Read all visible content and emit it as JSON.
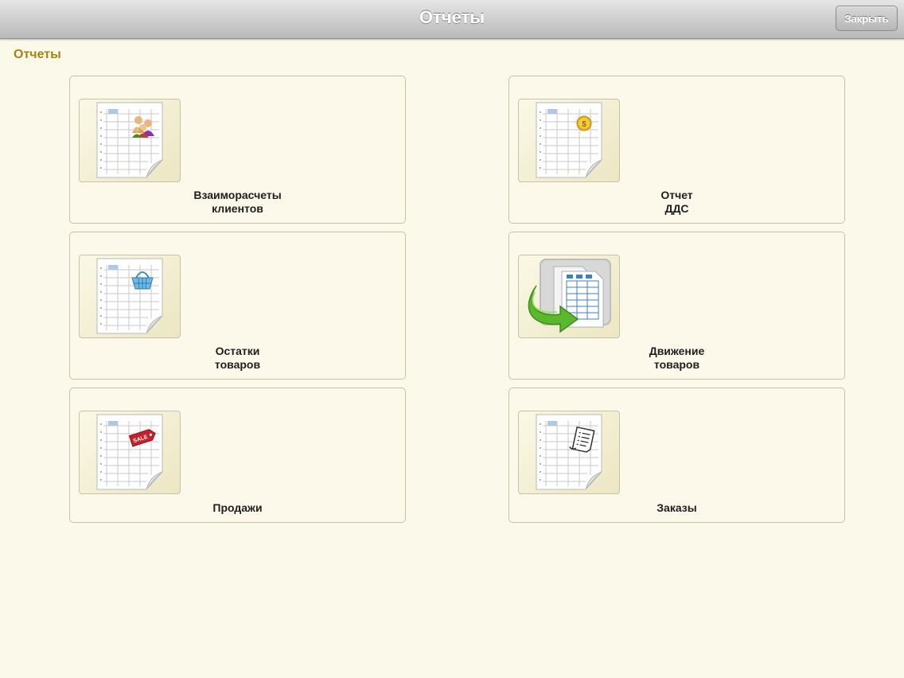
{
  "header": {
    "title": "Отчеты",
    "close_label": "Закрыть"
  },
  "section_title": "Отчеты",
  "reports": [
    {
      "line1": "Взаиморасчеты",
      "line2": "клиентов",
      "icon": "clients-report-icon"
    },
    {
      "line1": "Отчет",
      "line2": "ДДС",
      "icon": "cash-flow-report-icon"
    },
    {
      "line1": "Остатки",
      "line2": "товаров",
      "icon": "stock-report-icon"
    },
    {
      "line1": "Движение",
      "line2": "товаров",
      "icon": "goods-movement-icon"
    },
    {
      "line1": "Продажи",
      "line2": "",
      "icon": "sales-report-icon"
    },
    {
      "line1": "Заказы",
      "line2": "",
      "icon": "orders-report-icon"
    }
  ],
  "sale_tag_text": "SALE",
  "coin_symbol": "$",
  "colors": {
    "background": "#fbf9ea",
    "section_title": "#a4850c",
    "arrow_green": "#5bb82c"
  }
}
